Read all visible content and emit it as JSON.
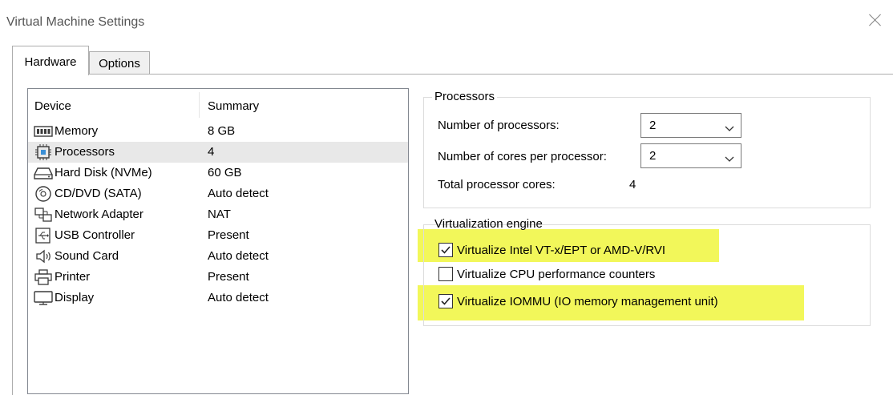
{
  "window": {
    "title": "Virtual Machine Settings"
  },
  "tabs": [
    {
      "label": "Hardware",
      "active": true
    },
    {
      "label": "Options",
      "active": false
    }
  ],
  "device_list": {
    "columns": [
      "Device",
      "Summary"
    ],
    "rows": [
      {
        "device": "Memory",
        "summary": "8 GB",
        "icon": "memory-icon",
        "selected": false
      },
      {
        "device": "Processors",
        "summary": "4",
        "icon": "processor-icon",
        "selected": true
      },
      {
        "device": "Hard Disk (NVMe)",
        "summary": "60 GB",
        "icon": "hard-disk-icon",
        "selected": false
      },
      {
        "device": "CD/DVD (SATA)",
        "summary": "Auto detect",
        "icon": "cd-dvd-icon",
        "selected": false
      },
      {
        "device": "Network Adapter",
        "summary": "NAT",
        "icon": "network-adapter-icon",
        "selected": false
      },
      {
        "device": "USB Controller",
        "summary": "Present",
        "icon": "usb-controller-icon",
        "selected": false
      },
      {
        "device": "Sound Card",
        "summary": "Auto detect",
        "icon": "sound-card-icon",
        "selected": false
      },
      {
        "device": "Printer",
        "summary": "Present",
        "icon": "printer-icon",
        "selected": false
      },
      {
        "device": "Display",
        "summary": "Auto detect",
        "icon": "display-icon",
        "selected": false
      }
    ]
  },
  "processors": {
    "legend": "Processors",
    "num_processors_label": "Number of processors:",
    "num_processors_value": "2",
    "cores_label": "Number of cores per processor:",
    "cores_value": "2",
    "total_label": "Total processor cores:",
    "total_value": "4"
  },
  "virtualization": {
    "legend": "Virtualization engine",
    "options": [
      {
        "label": "Virtualize Intel VT-x/EPT or AMD-V/RVI",
        "checked": true,
        "highlighted": true
      },
      {
        "label": "Virtualize CPU performance counters",
        "checked": false,
        "highlighted": false
      },
      {
        "label": "Virtualize IOMMU (IO memory management unit)",
        "checked": true,
        "highlighted": true
      }
    ]
  },
  "colors": {
    "highlight": "#f2f75a",
    "selected_row": "#e8e8e8",
    "border": "#adadad"
  }
}
